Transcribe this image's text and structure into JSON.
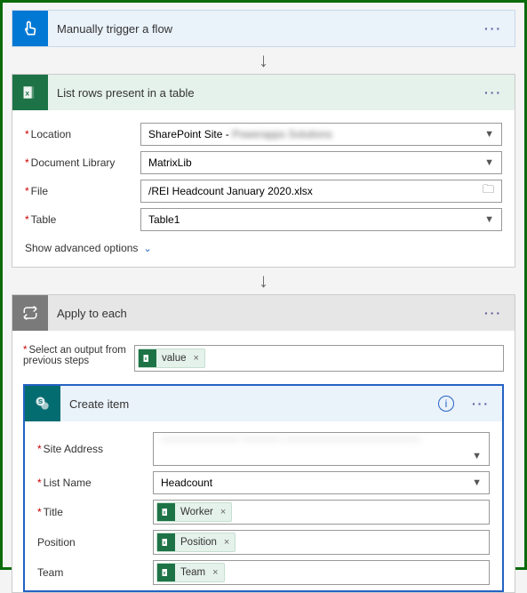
{
  "trigger": {
    "title": "Manually trigger a flow"
  },
  "excel": {
    "title": "List rows present in a table",
    "fields": {
      "location_label": "Location",
      "location_value": "SharePoint Site - ",
      "doclib_label": "Document Library",
      "doclib_value": "MatrixLib",
      "file_label": "File",
      "file_value": "/REI Headcount January 2020.xlsx",
      "table_label": "Table",
      "table_value": "Table1"
    },
    "show_advanced": "Show advanced options"
  },
  "apply": {
    "title": "Apply to each",
    "select_label": "Select an output from previous steps",
    "value_token": "value"
  },
  "create": {
    "title": "Create item",
    "fields": {
      "site_label": "Site Address",
      "site_value_blurred": "———————— ———— ——————————————",
      "list_label": "List Name",
      "list_value": "Headcount",
      "title_label": "Title",
      "title_token": "Worker",
      "position_label": "Position",
      "position_token": "Position",
      "team_label": "Team",
      "team_token": "Team"
    }
  }
}
